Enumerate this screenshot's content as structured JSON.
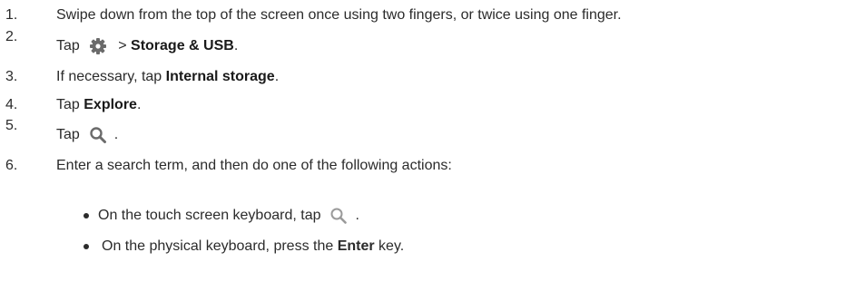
{
  "steps": [
    {
      "num": "1.",
      "text": "Swipe down from the top of the screen once using two fingers, or twice using one finger."
    },
    {
      "num": "2.",
      "pre": "Tap",
      "icon": "gear-icon",
      "mid": " > ",
      "bold": "Storage & USB",
      "post": "."
    },
    {
      "num": "3.",
      "pre": "If necessary, tap ",
      "bold": "Internal storage",
      "post": "."
    },
    {
      "num": "4.",
      "pre": "Tap ",
      "bold": "Explore",
      "post": "."
    },
    {
      "num": "5.",
      "pre": "Tap",
      "icon": "search-icon",
      "post": "."
    },
    {
      "num": "6.",
      "text": "Enter a search term, and then do one of the following actions:"
    }
  ],
  "bullets": [
    {
      "pre": "On the touch screen keyboard, tap",
      "icon": "search-icon",
      "post": "."
    },
    {
      "pre": "On the physical keyboard, press the ",
      "bold": "Enter",
      "post": " key."
    }
  ],
  "colors": {
    "text": "#2b2b2b",
    "icon": "#6b6b6b"
  }
}
